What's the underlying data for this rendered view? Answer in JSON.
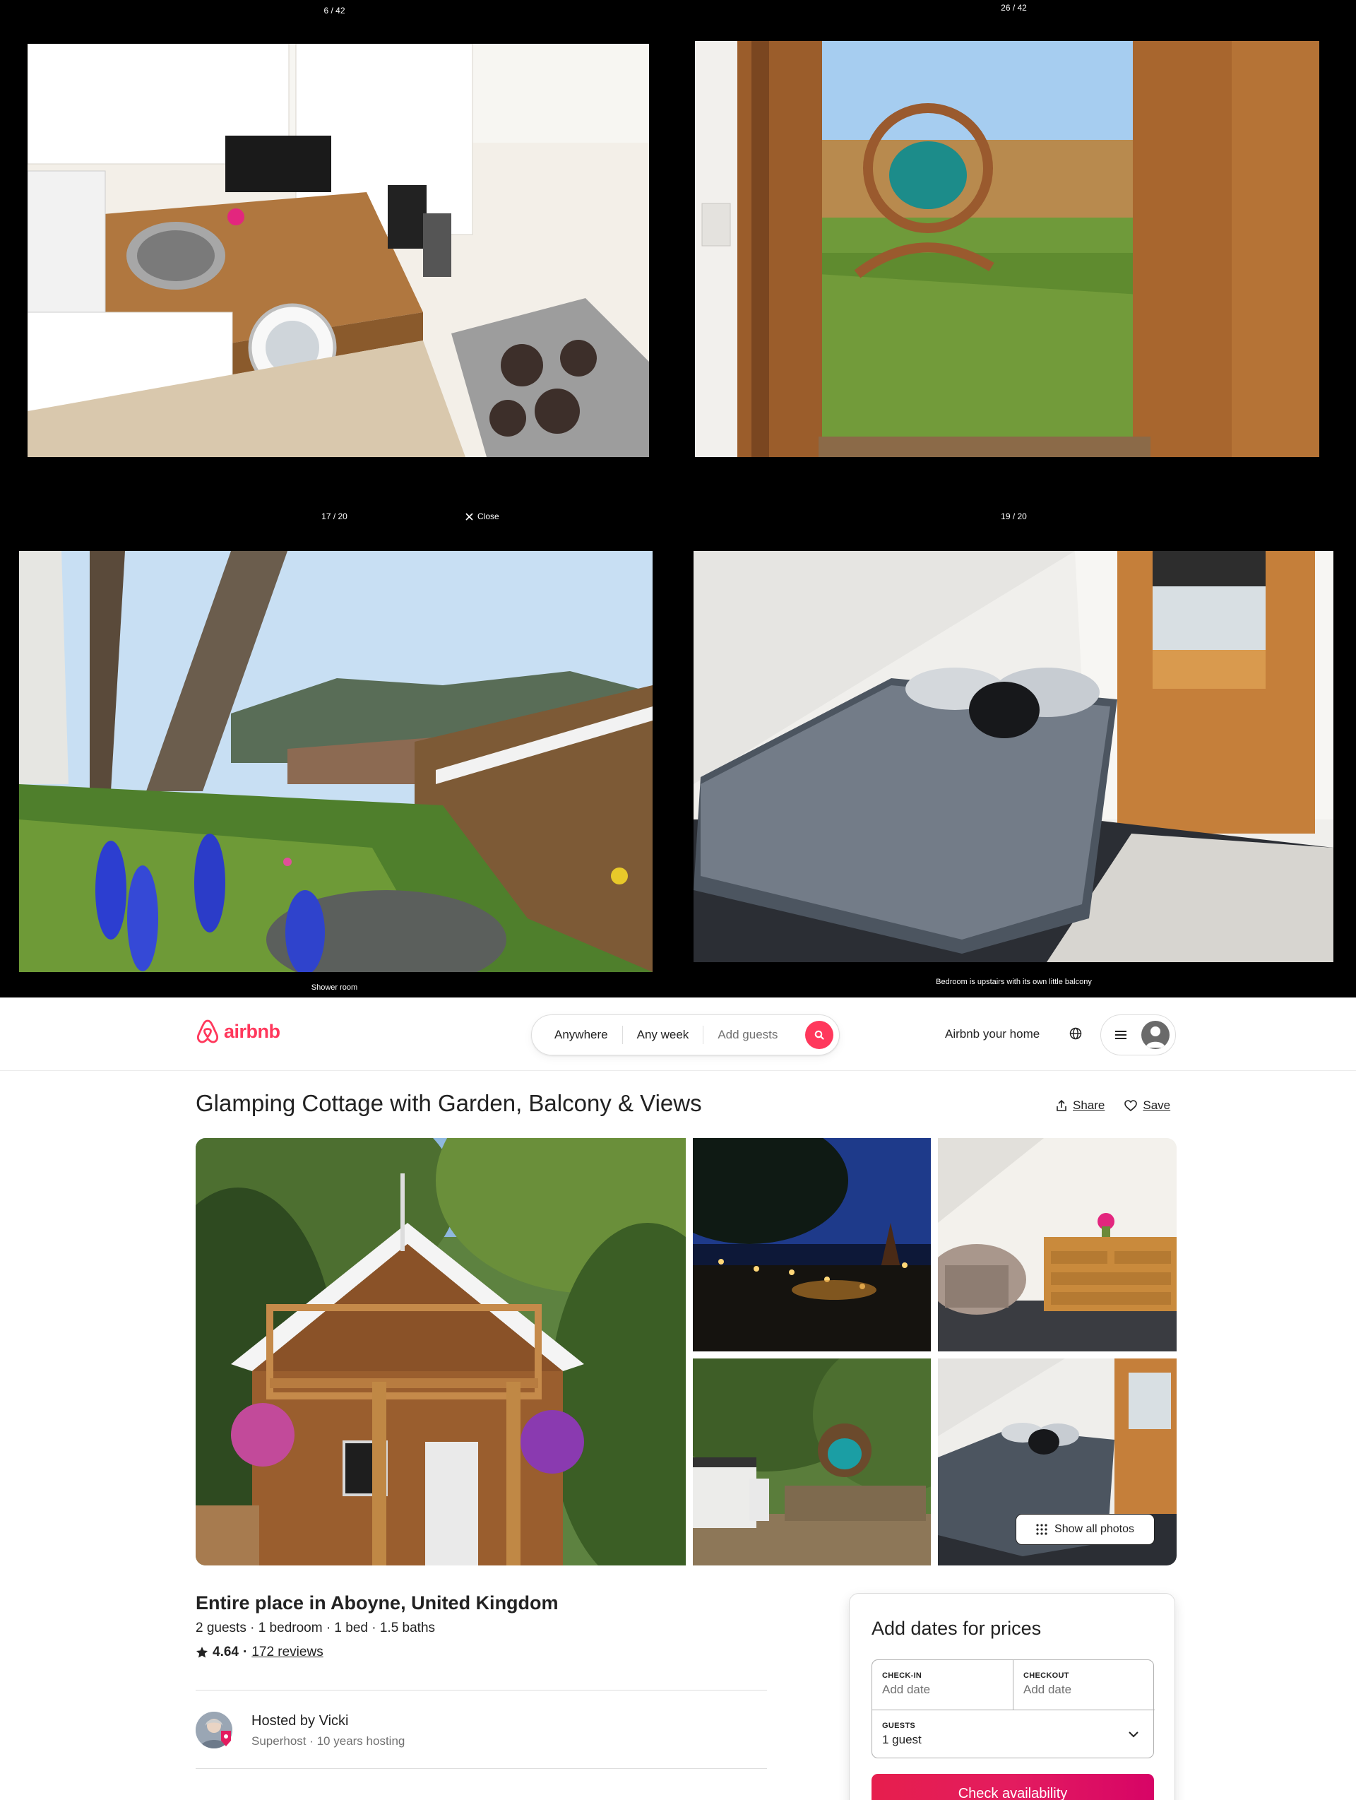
{
  "lightbox": {
    "panel1": {
      "counter": "6 / 42"
    },
    "panel2": {
      "counter": "26 / 42"
    },
    "panel3": {
      "counter": "17 / 20",
      "close_label": "Close",
      "caption": "Shower room"
    },
    "panel4": {
      "counter": "19 / 20",
      "caption": "Bedroom is upstairs with its own little balcony"
    }
  },
  "header": {
    "logo_text": "airbnb",
    "search": {
      "anywhere": "Anywhere",
      "any_week": "Any week",
      "add_guests": "Add guests"
    },
    "host_link": "Airbnb your home"
  },
  "listing": {
    "title": "Glamping Cottage with Garden, Balcony & Views",
    "share_label": "Share",
    "save_label": "Save",
    "show_all_photos": "Show all photos",
    "place_title": "Entire place in Aboyne, United Kingdom",
    "place_summary": "2 guests · 1 bedroom · 1 bed · 1.5 baths",
    "rating": "4.64",
    "rating_separator": "·",
    "reviews": "172 reviews",
    "host": {
      "name": "Hosted by Vicki",
      "meta": "Superhost · 10 years hosting"
    }
  },
  "booking": {
    "title": "Add dates for prices",
    "checkin_label": "CHECK-IN",
    "checkin_value": "Add date",
    "checkout_label": "CHECKOUT",
    "checkout_value": "Add date",
    "guests_label": "GUESTS",
    "guests_value": "1 guest",
    "cta": "Check availability"
  },
  "colors": {
    "brand": "#FF385C",
    "text": "#222222",
    "muted": "#717171",
    "border": "#DDDDDD"
  },
  "icons": [
    "airbnb-logo-icon",
    "search-icon",
    "globe-icon",
    "hamburger-menu-icon",
    "user-avatar-icon",
    "share-icon",
    "heart-icon",
    "grid-dots-icon",
    "star-icon",
    "chevron-down-icon",
    "close-icon",
    "superhost-badge-icon"
  ]
}
